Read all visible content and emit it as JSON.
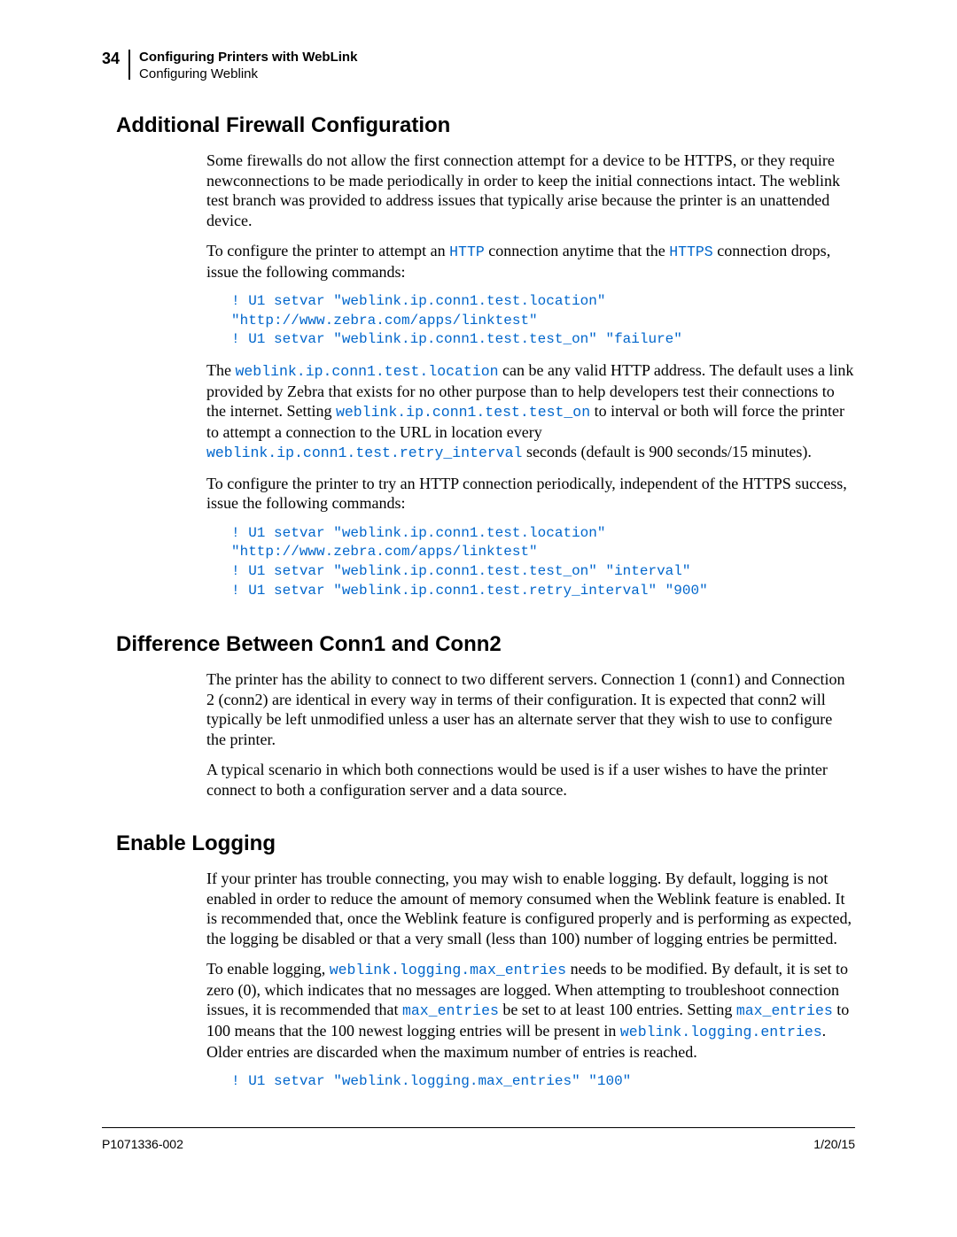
{
  "header": {
    "page_number": "34",
    "title": "Configuring Printers with WebLink",
    "subtitle": "Configuring Weblink"
  },
  "sections": {
    "s1": {
      "heading": "Additional Firewall Configuration",
      "p1a": "Some firewalls do not allow the first connection attempt for a device to be HTTPS, or they require newconnections to be made periodically in order to keep the initial connections intact. The weblink test branch was provided to address issues that typically arise because the printer is an unattended device.",
      "p2_pre": "To configure the printer to attempt an ",
      "p2_code1": "HTTP",
      "p2_mid": " connection anytime that the ",
      "p2_code2": "HTTPS",
      "p2_post": " connection drops, issue the following commands:",
      "code1": "! U1 setvar \"weblink.ip.conn1.test.location\" \"http://www.zebra.com/apps/linktest\"\n! U1 setvar \"weblink.ip.conn1.test.test_on\" \"failure\"",
      "p3_pre": "The ",
      "p3_code1": "weblink.ip.conn1.test.location",
      "p3_mid1": " can be any valid HTTP address. The default uses a link provided by Zebra that exists for no other purpose than to help developers test their connections to the internet. Setting ",
      "p3_code2": "weblink.ip.conn1.test.test_on",
      "p3_mid2": " to interval or both will force the printer to attempt a connection to the URL in location every ",
      "p3_code3": "weblink.ip.conn1.test.retry_interval",
      "p3_post": " seconds (default is 900 seconds/15 minutes).",
      "p4": "To configure the printer to try an HTTP connection periodically, independent of the HTTPS success, issue the following commands:",
      "code2": "! U1 setvar \"weblink.ip.conn1.test.location\" \"http://www.zebra.com/apps/linktest\"\n! U1 setvar \"weblink.ip.conn1.test.test_on\" \"interval\"\n! U1 setvar \"weblink.ip.conn1.test.retry_interval\" \"900\""
    },
    "s2": {
      "heading": "Difference Between Conn1 and Conn2",
      "p1": "The printer has the ability to connect to two different servers. Connection 1 (conn1) and Connection 2 (conn2) are identical in every way in terms of their configuration. It is expected that conn2 will typically be left unmodified unless a user has an alternate server that they wish to use to configure the printer.",
      "p2": "A typical scenario in which both connections would be used is if a user wishes to have the printer connect to both a configuration server and a data source."
    },
    "s3": {
      "heading": "Enable Logging",
      "p1": "If your printer has trouble connecting, you may wish to enable logging. By default, logging is not enabled in order to reduce the amount of memory consumed when the Weblink feature is enabled. It is recommended that, once the Weblink feature is configured properly and is performing as expected, the logging be disabled or that a very small (less than 100) number of logging entries be permitted.",
      "p2_pre": "To enable logging, ",
      "p2_code1": "weblink.logging.max_entries",
      "p2_mid1": " needs to be modified. By default, it is set to zero (0), which indicates that no messages are logged. When attempting to troubleshoot connection issues, it is recommended that ",
      "p2_code2": "max_entries",
      "p2_mid2": " be set to at least 100 entries. Setting ",
      "p2_code3": "max_entries",
      "p2_mid3": " to 100 means that the 100 newest logging entries will be present in ",
      "p2_code4": "weblink.logging.entries",
      "p2_post": ". Older entries are discarded when the maximum number of entries is reached.",
      "code1": "! U1 setvar \"weblink.logging.max_entries\" \"100\""
    }
  },
  "footer": {
    "left": "P1071336-002",
    "right": "1/20/15"
  }
}
